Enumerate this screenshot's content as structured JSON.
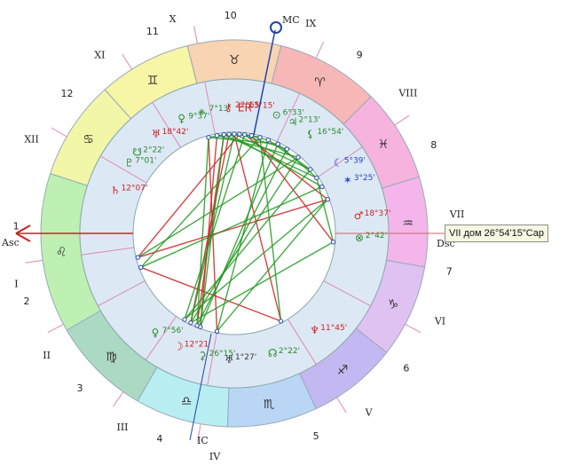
{
  "labels": {
    "mc": "MC",
    "ic": "IC",
    "asc": "Asc",
    "dsc": "Dsc"
  },
  "tooltip": "VII дом 26°54'15\"Cap",
  "house_cusps": [
    {
      "roman": "XII",
      "num": "12"
    },
    {
      "roman": "XI",
      "num": "11"
    },
    {
      "roman": "X",
      "num": "10"
    },
    {
      "roman": "IX",
      "num": "9"
    },
    {
      "roman": "VIII",
      "num": "8"
    },
    {
      "roman": "VII",
      "num": "7"
    },
    {
      "roman": "VI",
      "num": "6"
    },
    {
      "roman": "V",
      "num": "5"
    },
    {
      "roman": "IV",
      "num": "4"
    },
    {
      "roman": "III",
      "num": "3"
    },
    {
      "roman": "II",
      "num": "2"
    },
    {
      "roman": "I",
      "num": "1"
    }
  ],
  "signs": [
    {
      "glyph": "♋",
      "name": "cancer",
      "color": "#f2f7a8"
    },
    {
      "glyph": "♊",
      "name": "gemini",
      "color": "#f7f5a6"
    },
    {
      "glyph": "♉",
      "name": "taurus",
      "color": "#f8d4b2"
    },
    {
      "glyph": "♈",
      "name": "aries",
      "color": "#f7b7b7"
    },
    {
      "glyph": "♓",
      "name": "pisces",
      "color": "#f6b3dd"
    },
    {
      "glyph": "♒",
      "name": "aquarius",
      "color": "#f4b6ea"
    },
    {
      "glyph": "♑",
      "name": "capricorn",
      "color": "#dfc2f2"
    },
    {
      "glyph": "♐",
      "name": "sagittarius",
      "color": "#c4b8f2"
    },
    {
      "glyph": "♏",
      "name": "scorpio",
      "color": "#b9d6f4"
    },
    {
      "glyph": "♎",
      "name": "libra",
      "color": "#b8eef2"
    },
    {
      "glyph": "♍",
      "name": "virgo",
      "color": "#acd9c4"
    },
    {
      "glyph": "♌",
      "name": "leo",
      "color": "#bdf0b2"
    }
  ],
  "planets": [
    {
      "glyph": "♀",
      "deg": "9°37'",
      "color": "#2a8a2a"
    },
    {
      "glyph": "⚹",
      "deg": "7°13'",
      "color": "#2a8a2a"
    },
    {
      "glyph": "⚷",
      "deg": "22°55'",
      "color": "#cc2222"
    },
    {
      "glyph": "ER",
      "deg": "13°15'",
      "color": "#cc2222"
    },
    {
      "glyph": "⊙",
      "deg": "6°33'",
      "color": "#2a8a2a"
    },
    {
      "glyph": "♃",
      "deg": "2°13'",
      "color": "#2a8a2a"
    },
    {
      "glyph": "⚸",
      "deg": "16°54'",
      "color": "#2a8a2a"
    },
    {
      "glyph": "☾",
      "deg": "5°39'",
      "color": "#2244cc"
    },
    {
      "glyph": "✶",
      "deg": "3°25'",
      "color": "#2244cc"
    },
    {
      "glyph": "♂",
      "deg": "18°37'",
      "color": "#cc2222"
    },
    {
      "glyph": "⊗",
      "deg": "2°42'",
      "color": "#2a8a2a"
    },
    {
      "glyph": "♆",
      "deg": "11°45'",
      "color": "#cc2222"
    },
    {
      "glyph": "☊",
      "deg": "2°22'",
      "color": "#2a8a2a"
    },
    {
      "glyph": "♅",
      "deg": "1°27'",
      "color": "#333333"
    },
    {
      "glyph": "⚳",
      "deg": "26°15'",
      "color": "#2a8a2a"
    },
    {
      "glyph": "☽",
      "deg": "12°21'",
      "color": "#cc2222"
    },
    {
      "glyph": "♀",
      "deg": "7°56'",
      "color": "#2a8a2a"
    },
    {
      "glyph": "♄",
      "deg": "12°07'",
      "color": "#cc2222"
    },
    {
      "glyph": "♇",
      "deg": "7°01'",
      "color": "#2a8a2a"
    },
    {
      "glyph": "☋",
      "deg": "2°22'",
      "color": "#2a8a2a"
    },
    {
      "glyph": "♅",
      "deg": "18°42'",
      "color": "#cc2222"
    }
  ]
}
